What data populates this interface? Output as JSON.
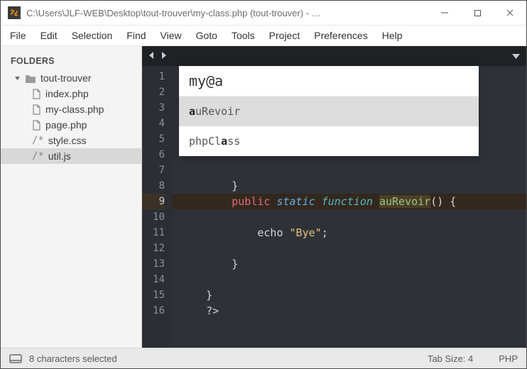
{
  "titlebar": {
    "title": "C:\\Users\\JLF-WEB\\Desktop\\tout-trouver\\my-class.php (tout-trouver) - Sublime …"
  },
  "menubar": {
    "items": [
      "File",
      "Edit",
      "Selection",
      "Find",
      "View",
      "Goto",
      "Tools",
      "Project",
      "Preferences",
      "Help"
    ]
  },
  "sidebar": {
    "header": "FOLDERS",
    "root": "tout-trouver",
    "files": {
      "f0": "index.php",
      "f1": "my-class.php",
      "f2": "page.php",
      "f3": "style.css",
      "f4": "util.js"
    }
  },
  "gutter": {
    "l1": "1",
    "l2": "2",
    "l3": "3",
    "l4": "4",
    "l5": "5",
    "l6": "6",
    "l7": "7",
    "l8": "8",
    "l9": "9",
    "l10": "10",
    "l11": "11",
    "l12": "12",
    "l13": "13",
    "l14": "14",
    "l15": "15",
    "l16": "16"
  },
  "code": {
    "l8": "        }",
    "l9_kw1": "public",
    "l9_kw2": "static",
    "l9_kw3": "function",
    "l9_fn": "auRevoir",
    "l9_tail": "() {",
    "l11_pre": "            echo ",
    "l11_str": "\"Bye\"",
    "l11_post": ";",
    "l13": "        }",
    "l15": "    }",
    "l16": "    ?>"
  },
  "autocomplete": {
    "query": "my@a",
    "item0_b": "a",
    "item0_rest": "uRevoir",
    "item1_pre": "phpCl",
    "item1_b": "a",
    "item1_post": "ss"
  },
  "statusbar": {
    "selection": "8 characters selected",
    "tabsize_label": "Tab Size: 4",
    "syntax": "PHP"
  }
}
